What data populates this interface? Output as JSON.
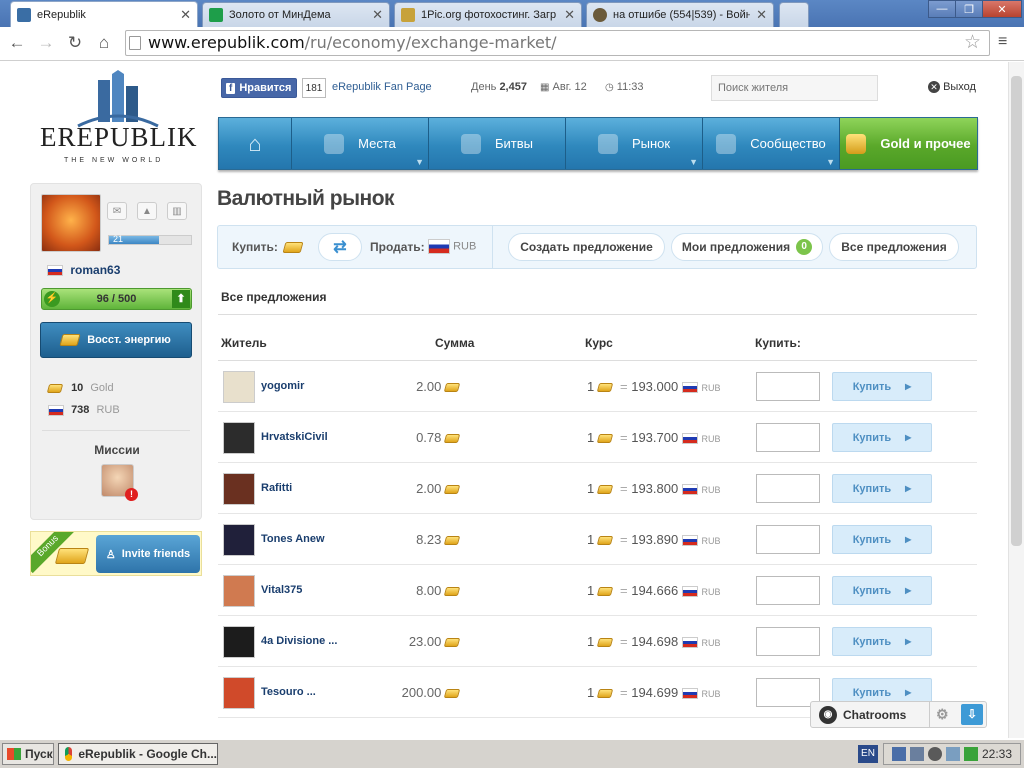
{
  "browser": {
    "tabs": [
      {
        "label": "eRepublik",
        "active": true
      },
      {
        "label": "Золото от МинДема",
        "active": false
      },
      {
        "label": "1Pic.org фотохостинг. Загр",
        "active": false
      },
      {
        "label": "на отшибе (554|539) - Войн",
        "active": false
      }
    ],
    "url_host": "www.erepublik.com",
    "url_path": "/ru/economy/exchange-market/"
  },
  "header": {
    "logo_text": "EREPUBLIK",
    "logo_sub": "THE NEW WORLD",
    "fb_like": "Нравится",
    "fb_count": "181",
    "fan_page": "eRepublik Fan Page",
    "day_label": "День",
    "day_value": "2,457",
    "date": "Авг. 12",
    "time": "11:33",
    "search_placeholder": "Поиск жителя",
    "logout": "Выход"
  },
  "menu": [
    {
      "label": "",
      "name": "home"
    },
    {
      "label": "Места",
      "name": "places"
    },
    {
      "label": "Битвы",
      "name": "battles"
    },
    {
      "label": "Рынок",
      "name": "market"
    },
    {
      "label": "Сообщество",
      "name": "community"
    },
    {
      "label": "Gold и прочее",
      "name": "gold"
    }
  ],
  "sidebar": {
    "level": "21",
    "username": "roman63",
    "energy": "96 / 500",
    "restore_label": "Восст. энергию",
    "gold_amount": "10",
    "gold_label": "Gold",
    "rub_amount": "738",
    "rub_label": "RUB",
    "missions_label": "Миссии",
    "bonus_label": "Bonus",
    "invite_label": "Invite friends"
  },
  "main": {
    "title": "Валютный рынок",
    "buy_label": "Купить:",
    "sell_label": "Продать:",
    "sell_currency": "RUB",
    "create_offer": "Создать предложение",
    "my_offers": "Мои предложения",
    "my_offers_count": "0",
    "all_offers_btn": "Все предложения",
    "section_title": "Все предложения",
    "columns": [
      "Житель",
      "Сумма",
      "Курс",
      "Купить:"
    ],
    "buy_button": "Купить",
    "rate_unit": "1",
    "rate_currency": "RUB",
    "offers": [
      {
        "citizen": "yogomir",
        "amount": "2.00",
        "rate": "193.000"
      },
      {
        "citizen": "HrvatskiCivil",
        "amount": "0.78",
        "rate": "193.700"
      },
      {
        "citizen": "Rafitti",
        "amount": "2.00",
        "rate": "193.800"
      },
      {
        "citizen": "Tones Anew",
        "amount": "8.23",
        "rate": "193.890"
      },
      {
        "citizen": "Vital375",
        "amount": "8.00",
        "rate": "194.666"
      },
      {
        "citizen": "4a Divisione ...",
        "amount": "23.00",
        "rate": "194.698"
      },
      {
        "citizen": "Tesouro ...",
        "amount": "200.00",
        "rate": "194.699"
      }
    ]
  },
  "chat": {
    "label": "Chatrooms"
  },
  "taskbar": {
    "start": "Пуск",
    "task": "eRepublik - Google Ch...",
    "lang": "EN",
    "clock": "22:33"
  }
}
